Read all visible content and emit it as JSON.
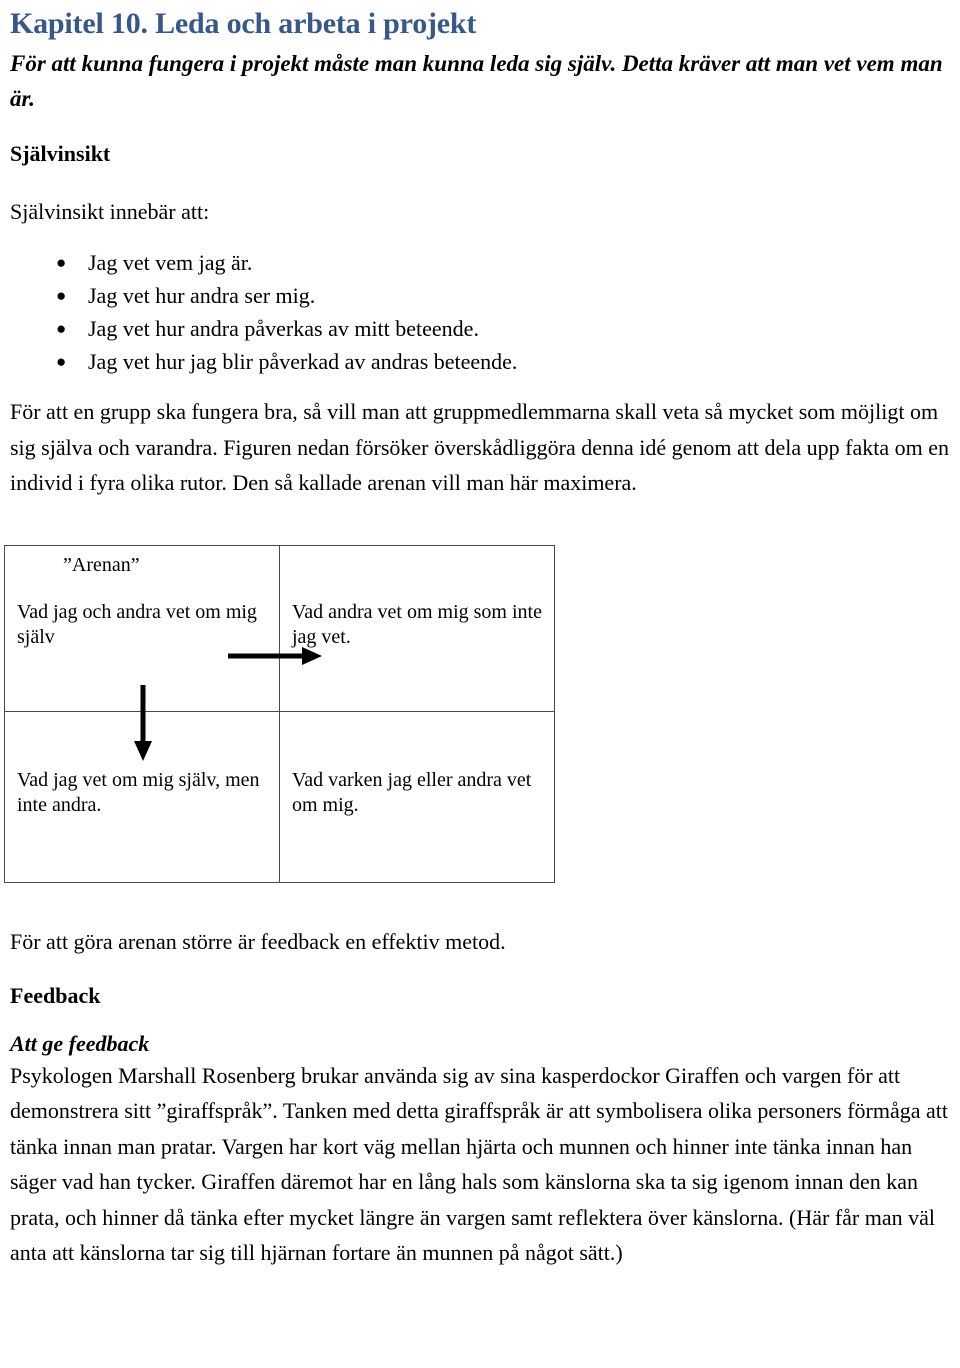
{
  "document": {
    "chapter_title": "Kapitel 10. Leda och arbeta i projekt",
    "lead_paragraph": "För att kunna fungera i projekt måste man kunna leda sig själv. Detta kräver att man vet vem man är.",
    "sections": {
      "sjalvinsikt": {
        "heading": "Självinsikt",
        "intro": "Självinsikt innebär att:",
        "bullets": [
          {
            "glyph": "●",
            "text": "Jag vet vem jag är."
          },
          {
            "glyph": "●",
            "text": "Jag vet hur andra ser mig."
          },
          {
            "glyph": "●",
            "text": "Jag vet hur andra påverkas av mitt beteende."
          },
          {
            "glyph": "●",
            "text": "Jag vet hur jag blir påverkad av andras beteende."
          }
        ],
        "paragraph": "För att en grupp ska fungera bra, så vill man att gruppmedlemmarna skall veta så mycket som möjligt om sig själva och varandra. Figuren nedan försöker överskådliggöra denna idé genom att dela upp fakta om en individ i fyra olika rutor. Den så kallade arenan vill man här maximera."
      },
      "after_figure": {
        "paragraph": "För att göra arenan större är feedback en effektiv metod."
      },
      "feedback": {
        "heading": "Feedback",
        "sub_heading": "Att ge feedback",
        "paragraph": "Psykologen Marshall Rosenberg brukar använda sig av sina kasperdockor Giraffen och vargen för att demonstrera sitt ”giraffspråk”. Tanken med detta giraffspråk är att symbolisera olika personers förmåga att tänka innan man pratar. Vargen har kort väg mellan hjärta och munnen och hinner inte tänka innan han säger vad han tycker. Giraffen däremot har en lång hals som känslorna ska ta sig igenom innan den kan prata, och hinner då tänka efter mycket längre än vargen samt reflektera över känslorna. (Här får man väl anta att känslorna tar sig till hjärnan fortare än munnen på något sätt.)"
      }
    },
    "johari_window": {
      "arena_label": "”Arenan”",
      "quadrants": [
        {
          "id": "arena",
          "text": "Vad  jag och andra vet om mig själv"
        },
        {
          "id": "blind-spot",
          "text": "Vad andra vet om mig som inte jag vet."
        },
        {
          "id": "hidden",
          "text": "Vad jag vet om mig själv, men inte andra."
        },
        {
          "id": "unknown",
          "text": "Vad varken jag eller andra vet om mig."
        }
      ],
      "arrows": [
        {
          "id": "arrow-right",
          "direction": "right"
        },
        {
          "id": "arrow-down",
          "direction": "down"
        }
      ]
    },
    "colors": {
      "title_blue": "#36598A",
      "text_black": "#000000",
      "table_border": "#4a4a4a",
      "page_background": "#ffffff"
    }
  }
}
